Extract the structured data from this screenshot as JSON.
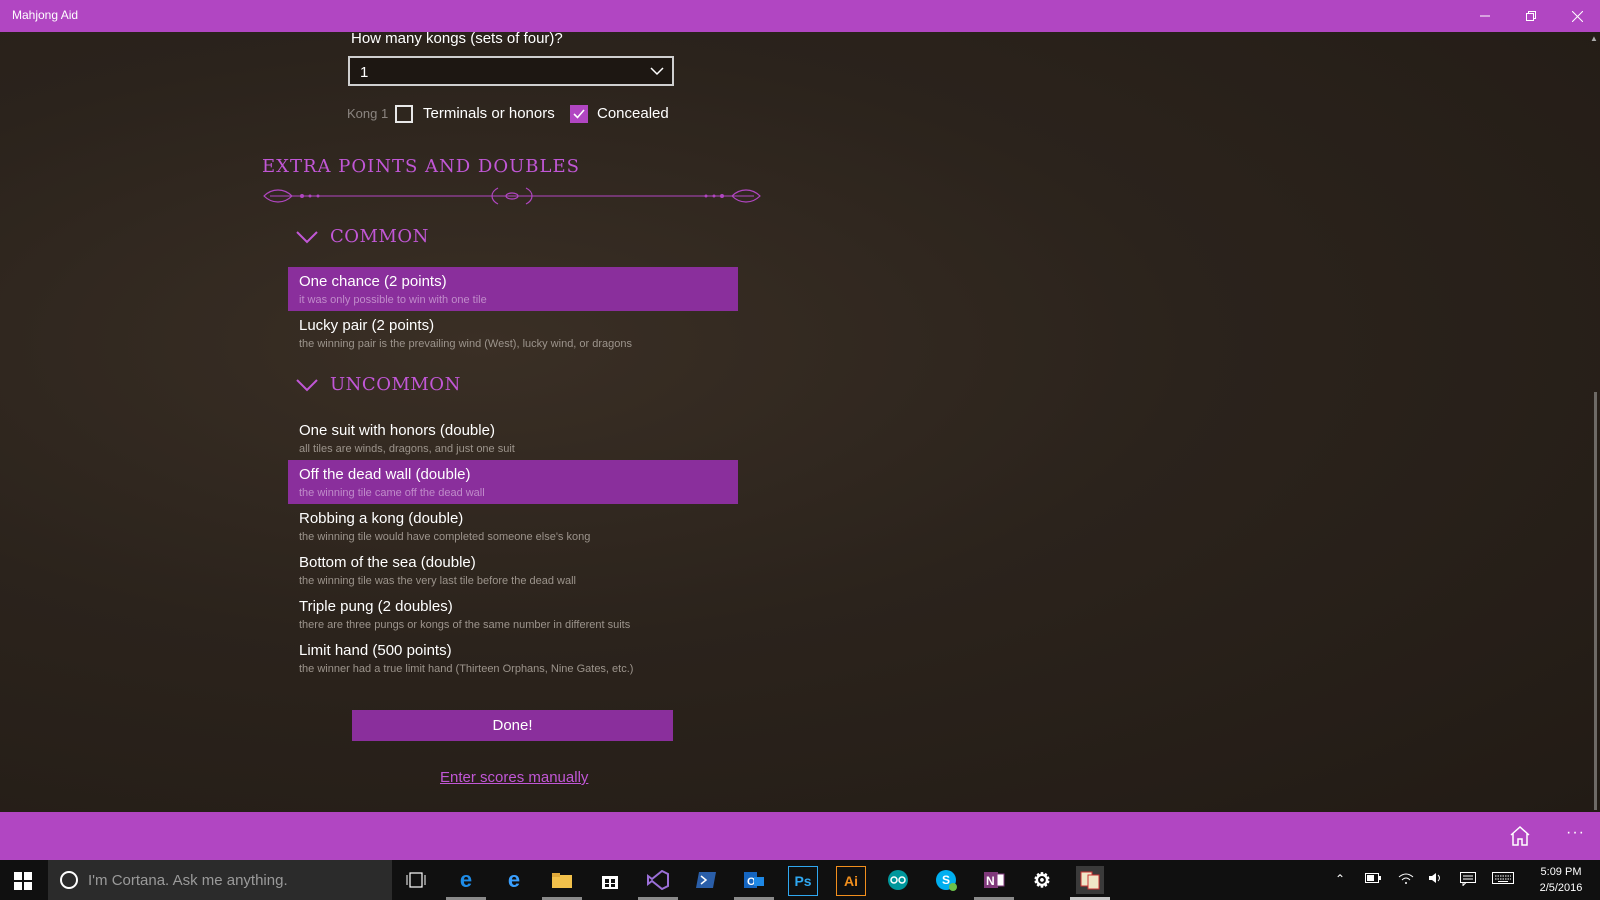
{
  "window": {
    "title": "Mahjong Aid"
  },
  "kongs": {
    "question": "How many kongs (sets of four)?",
    "count_value": "1",
    "kong_label": "Kong 1",
    "terminals_label": "Terminals or honors",
    "terminals_checked": false,
    "concealed_label": "Concealed",
    "concealed_checked": true
  },
  "extras": {
    "title": "EXTRA POINTS AND DOUBLES",
    "groups": [
      {
        "name": "COMMON",
        "items": [
          {
            "title": "One chance (2 points)",
            "desc": "it was only possible to win with one tile",
            "selected": true
          },
          {
            "title": "Lucky pair (2 points)",
            "desc": "the winning pair is the prevailing wind (West), lucky wind, or dragons",
            "selected": false
          }
        ]
      },
      {
        "name": "UNCOMMON",
        "items": [
          {
            "title": "One suit with honors (double)",
            "desc": "all tiles are winds, dragons, and just one suit",
            "selected": false
          },
          {
            "title": "Off the dead wall (double)",
            "desc": "the winning tile came off the dead wall",
            "selected": true
          },
          {
            "title": "Robbing a kong (double)",
            "desc": "the winning tile would have completed someone else's kong",
            "selected": false
          },
          {
            "title": "Bottom of the sea (double)",
            "desc": "the winning tile was the very last tile before the dead wall",
            "selected": false
          },
          {
            "title": "Triple pung (2 doubles)",
            "desc": "there are three pungs or kongs of the same number in different suits",
            "selected": false
          },
          {
            "title": "Limit hand (500 points)",
            "desc": "the winner had a true limit hand (Thirteen Orphans, Nine Gates, etc.)",
            "selected": false
          }
        ]
      }
    ]
  },
  "actions": {
    "done_label": "Done!",
    "manual_label": "Enter scores manually"
  },
  "appbar": {
    "home_icon": "home-icon",
    "more_label": "···"
  },
  "taskbar": {
    "cortana_placeholder": "I'm Cortana. Ask me anything.",
    "apps": [
      "task-view",
      "edge",
      "internet-explorer",
      "file-explorer",
      "store",
      "visual-studio",
      "powershell",
      "outlook",
      "photoshop",
      "illustrator",
      "arduino",
      "skype",
      "onenote",
      "settings",
      "mahjong-aid"
    ],
    "ps_label": "Ps",
    "ai_label": "Ai",
    "time": "5:09 PM",
    "date": "2/5/2016"
  },
  "colors": {
    "accent": "#b146c2",
    "selected": "#8a2f9c",
    "heading": "#c157d6"
  }
}
